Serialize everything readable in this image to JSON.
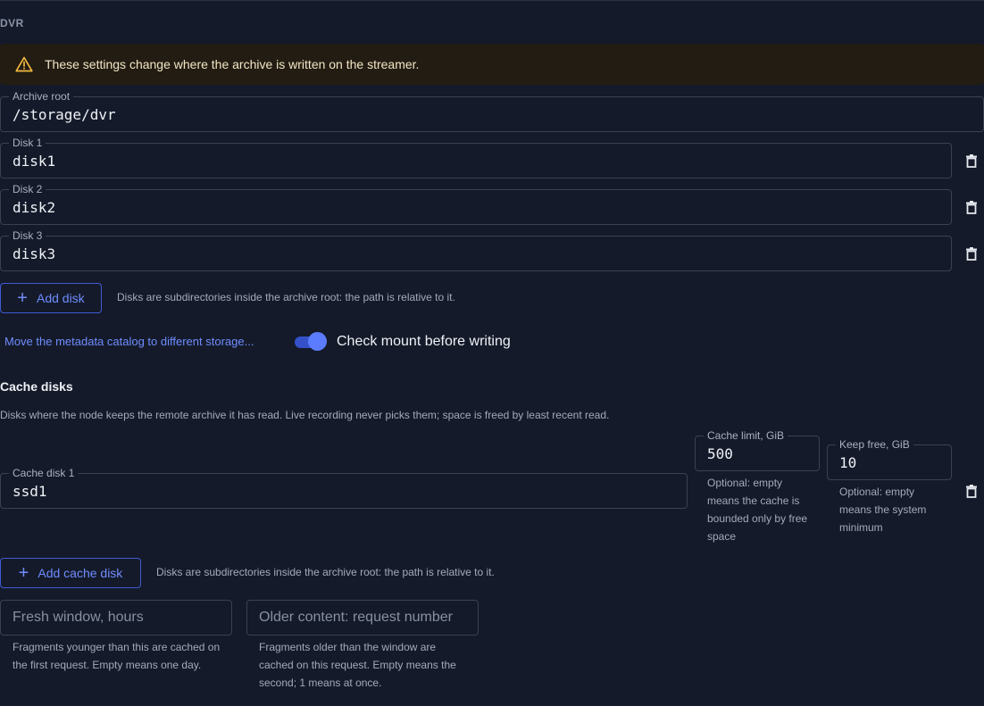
{
  "section": {
    "label": "DVR"
  },
  "alert": {
    "icon": "warning-icon",
    "message": "These settings change where the archive is written on the streamer."
  },
  "archive_root": {
    "label": "Archive root",
    "value": "/storage/dvr"
  },
  "disks": [
    {
      "label": "Disk 1",
      "value": "disk1"
    },
    {
      "label": "Disk 2",
      "value": "disk2"
    },
    {
      "label": "Disk 3",
      "value": "disk3"
    }
  ],
  "add_disk": {
    "label": "Add disk",
    "hint": "Disks are subdirectories inside the archive root: the path is relative to it."
  },
  "metadata_link": "Move the metadata catalog to different storage...",
  "check_mount": {
    "label": "Check mount before writing",
    "enabled": true
  },
  "cache": {
    "heading": "Cache disks",
    "description": "Disks where the node keeps the remote archive it has read. Live recording never picks them; space is freed by least recent read.",
    "disk": {
      "label": "Cache disk 1",
      "value": "ssd1"
    },
    "limit": {
      "label": "Cache limit, GiB",
      "value": "500",
      "helper": "Optional: empty means the cache is bounded only by free space"
    },
    "keep_free": {
      "label": "Keep free, GiB",
      "value": "10",
      "helper": "Optional: empty means the system minimum"
    },
    "add_label": "Add cache disk",
    "add_hint": "Disks are subdirectories inside the archive root: the path is relative to it."
  },
  "fresh_window": {
    "placeholder": "Fresh window, hours",
    "helper": "Fragments younger than this are cached on the first request. Empty means one day."
  },
  "older_content": {
    "placeholder": "Older content: request number",
    "helper": "Fragments older than the window are cached on this request. Empty means the second; 1 means at once."
  },
  "colors": {
    "background": "#141a29",
    "accent": "#5b7cff",
    "warning_bg": "#221c12",
    "warning_icon": "#f5b942"
  }
}
